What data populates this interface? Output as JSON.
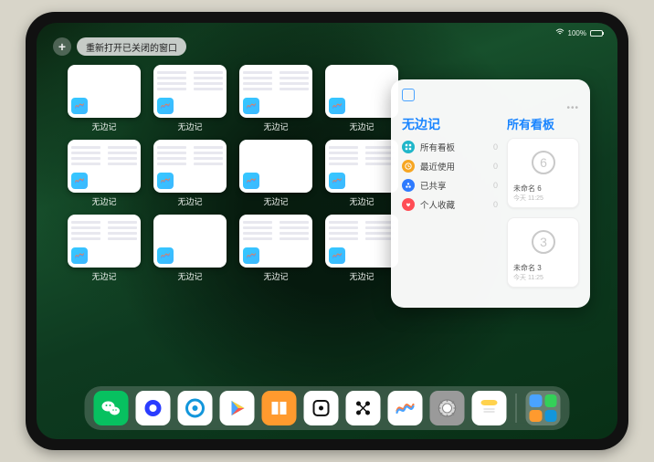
{
  "status": {
    "battery_pct": "100%"
  },
  "reopen": {
    "plus_glyph": "+",
    "label": "重新打开已关闭的窗口"
  },
  "windows": [
    {
      "label": "无边记",
      "variant": "a"
    },
    {
      "label": "无边记",
      "variant": "b"
    },
    {
      "label": "无边记",
      "variant": "b"
    },
    {
      "label": "无边记",
      "variant": "a"
    },
    {
      "label": "无边记",
      "variant": "b"
    },
    {
      "label": "无边记",
      "variant": "b"
    },
    {
      "label": "无边记",
      "variant": "a"
    },
    {
      "label": "无边记",
      "variant": "b"
    },
    {
      "label": "无边记",
      "variant": "b"
    },
    {
      "label": "无边记",
      "variant": "a"
    },
    {
      "label": "无边记",
      "variant": "b"
    },
    {
      "label": "无边记",
      "variant": "b"
    }
  ],
  "panel": {
    "left_title": "无边记",
    "rows": [
      {
        "icon": "grid",
        "color": "#1fb6c9",
        "label": "所有看板",
        "count": "0"
      },
      {
        "icon": "clock",
        "color": "#f6a623",
        "label": "最近使用",
        "count": "0"
      },
      {
        "icon": "share",
        "color": "#2e7bff",
        "label": "已共享",
        "count": "0"
      },
      {
        "icon": "heart",
        "color": "#ff4d55",
        "label": "个人收藏",
        "count": "0"
      }
    ],
    "right_title": "所有看板",
    "boards": [
      {
        "digit": "6",
        "title": "未命名 6",
        "sub": "今天 11:25"
      },
      {
        "digit": "3",
        "title": "未命名 3",
        "sub": "今天 11:25"
      }
    ]
  },
  "dock": {
    "apps": [
      {
        "name": "wechat",
        "bg": "#07c160"
      },
      {
        "name": "quark",
        "bg": "#ffffff"
      },
      {
        "name": "qqbrowser",
        "bg": "#ffffff"
      },
      {
        "name": "play",
        "bg": "#ffffff"
      },
      {
        "name": "books",
        "bg": "#ff9a2e"
      },
      {
        "name": "dice",
        "bg": "#ffffff"
      },
      {
        "name": "nodes",
        "bg": "#ffffff"
      },
      {
        "name": "freeform",
        "bg": "#ffffff"
      },
      {
        "name": "settings",
        "bg": "#9a9a9a"
      },
      {
        "name": "notes",
        "bg": "#ffffff"
      }
    ]
  }
}
